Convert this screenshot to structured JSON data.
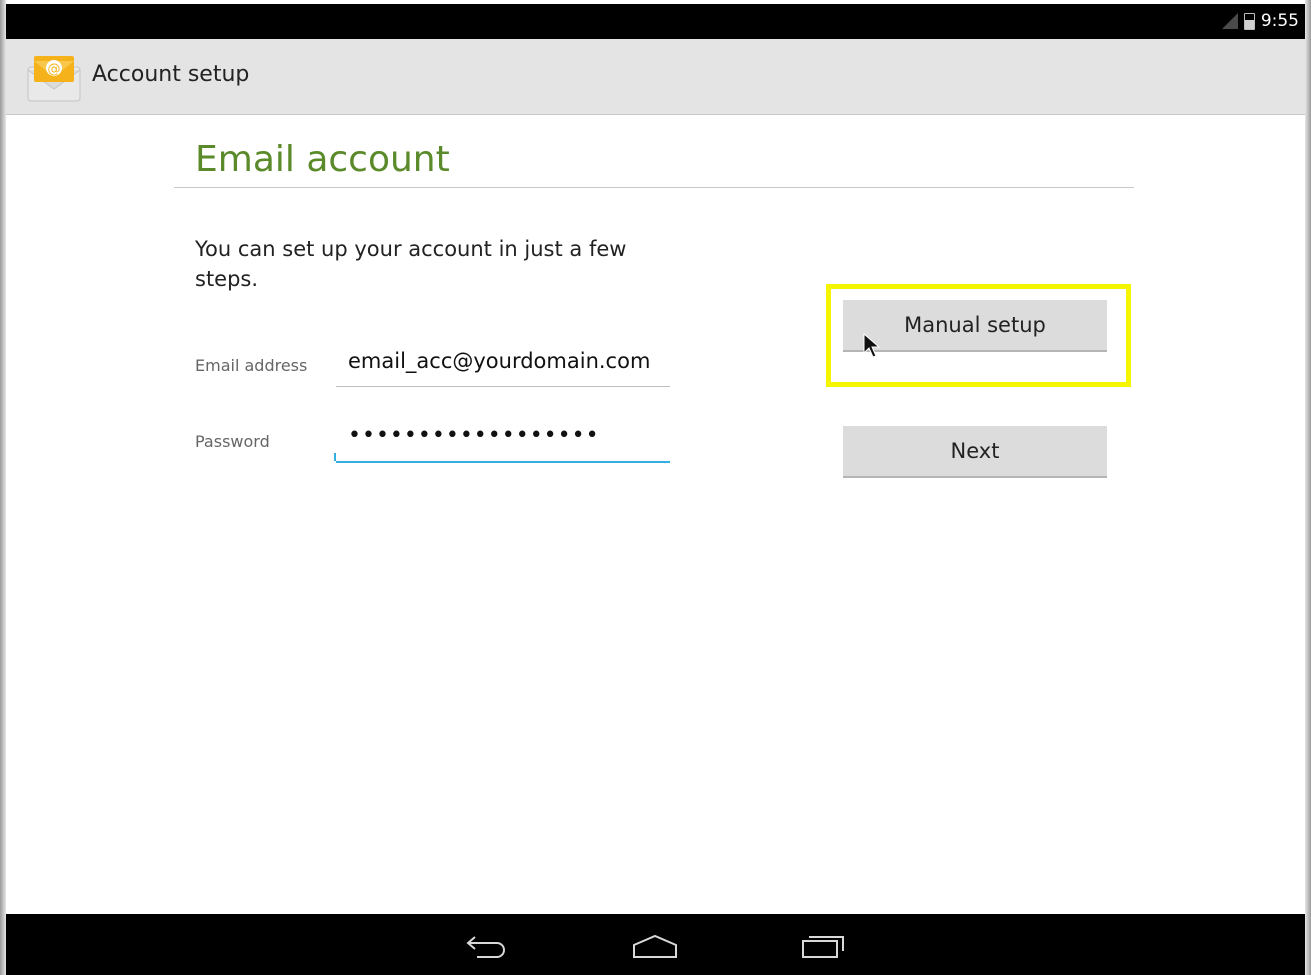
{
  "status_bar": {
    "time": "9:55",
    "icons": [
      "signal-icon",
      "battery-icon"
    ]
  },
  "action_bar": {
    "app_icon": "email-envelope-icon",
    "title": "Account setup"
  },
  "form": {
    "heading": "Email account",
    "intro": "You can set up your account in just a few steps.",
    "email_label": "Email address",
    "email_value": "email_acc@yourdomain.com",
    "password_label": "Password",
    "password_value": "••••••••••••••••••"
  },
  "buttons": {
    "manual_setup": "Manual setup",
    "next": "Next"
  },
  "nav_bar": {
    "icons": [
      "back-icon",
      "home-icon",
      "recent-apps-icon"
    ]
  },
  "colors": {
    "heading_green": "#5a8a2a",
    "focus_blue": "#33aee0",
    "highlight_yellow": "#f5f500"
  }
}
